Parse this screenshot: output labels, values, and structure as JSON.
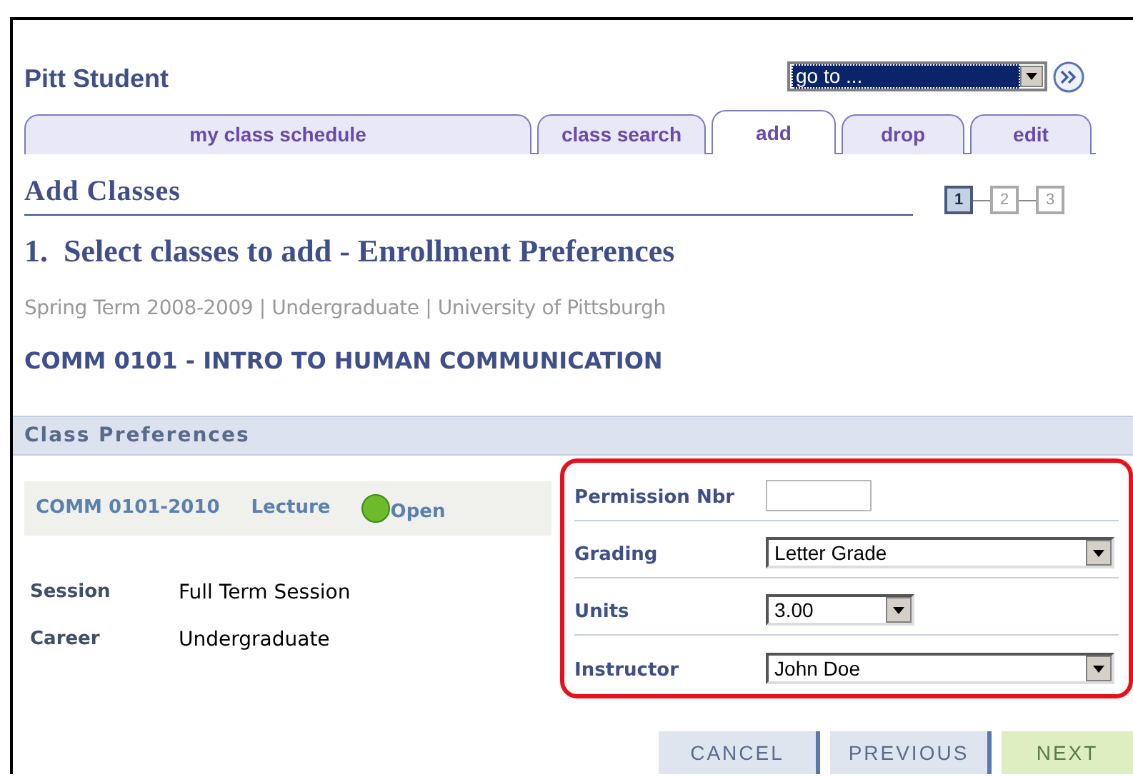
{
  "header": {
    "title": "Pitt Student",
    "goto": {
      "value": "go to ..."
    }
  },
  "tabs": [
    {
      "label": "my class schedule",
      "selected": false
    },
    {
      "label": "class search",
      "selected": false
    },
    {
      "label": "add",
      "selected": true
    },
    {
      "label": "drop",
      "selected": false
    },
    {
      "label": "edit",
      "selected": false
    }
  ],
  "page_title": "Add Classes",
  "steps": [
    {
      "label": "1",
      "selected": true
    },
    {
      "label": "2",
      "selected": false
    },
    {
      "label": "3",
      "selected": false
    }
  ],
  "heading": "1.  Select classes to add - Enrollment Preferences",
  "term": "Spring Term 2008-2009 | Undergraduate | University of Pittsburgh",
  "course_title": "COMM 0101 - INTRO TO HUMAN COMMUNICATION",
  "section_title": "Class Preferences",
  "class_row": {
    "section": "COMM 0101-2010",
    "component": "Lecture",
    "status": {
      "label": "Open",
      "open": true
    }
  },
  "details": [
    {
      "label": "Session",
      "value": "Full Term Session"
    },
    {
      "label": "Career",
      "value": "Undergraduate"
    }
  ],
  "preferences": [
    {
      "label": "Permission Nbr",
      "kind": "input"
    },
    {
      "label": "Grading",
      "kind": "select",
      "value": "Letter Grade",
      "wide": true
    },
    {
      "label": "Units",
      "kind": "select",
      "value": "3.00",
      "wide": false
    },
    {
      "label": "Instructor",
      "kind": "select",
      "value": "John Doe",
      "wide": true
    }
  ],
  "buttons": [
    {
      "label": "CANCEL",
      "primary": false
    },
    {
      "label": "PREVIOUS",
      "primary": false
    },
    {
      "label": "NEXT",
      "primary": true
    }
  ]
}
